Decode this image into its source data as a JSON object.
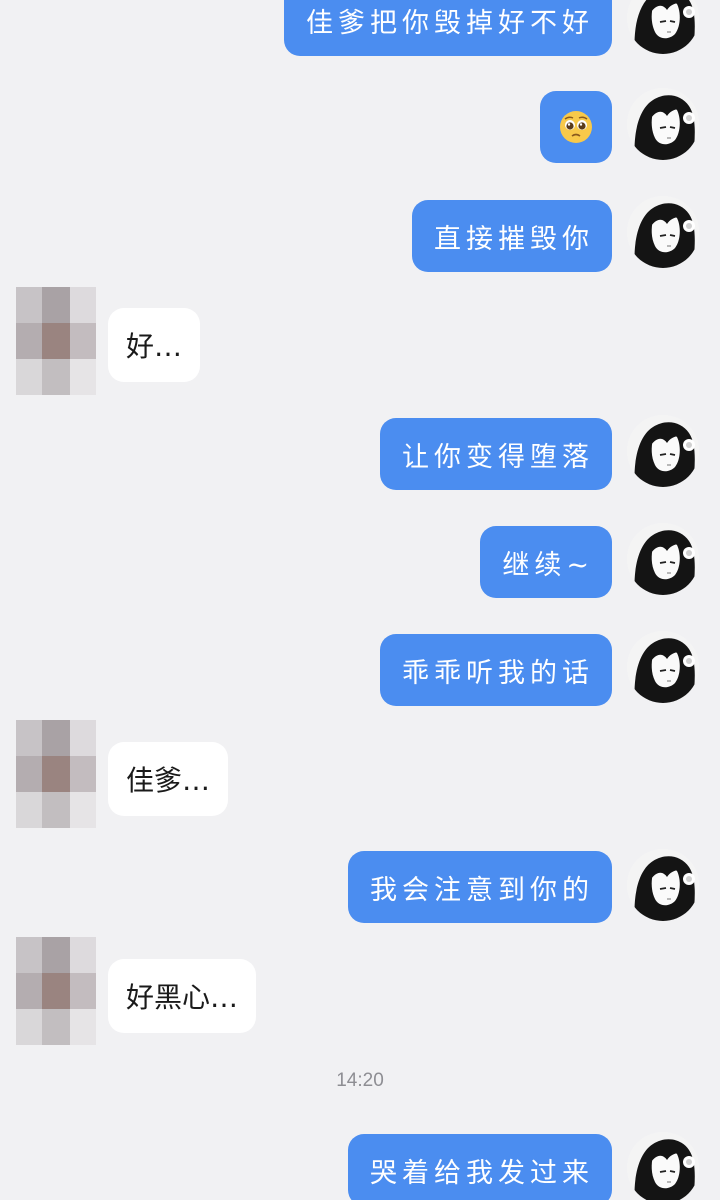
{
  "conversation": {
    "outgoing": [
      {
        "text": "佳爹把你毁掉好不好",
        "avatar_icon": "anime-girl-avatar-icon"
      },
      {
        "text": "",
        "emoji": "pleading-face-emoji",
        "avatar_icon": "anime-girl-avatar-icon"
      },
      {
        "text": "直接摧毁你",
        "avatar_icon": "anime-girl-avatar-icon"
      },
      {
        "text": "让你变得堕落",
        "avatar_icon": "anime-girl-avatar-icon"
      },
      {
        "text": "继续~",
        "avatar_icon": "anime-girl-avatar-icon"
      },
      {
        "text": "乖乖听我的话",
        "avatar_icon": "anime-girl-avatar-icon"
      },
      {
        "text": "我会注意到你的",
        "avatar_icon": "anime-girl-avatar-icon"
      },
      {
        "text": "哭着给我发过来",
        "avatar_icon": "anime-girl-avatar-icon"
      }
    ],
    "incoming": [
      {
        "text": "好…",
        "avatar_icon": "pixelated-avatar-icon"
      },
      {
        "text": "佳爹…",
        "avatar_icon": "pixelated-avatar-icon"
      },
      {
        "text": "好黑心…",
        "avatar_icon": "pixelated-avatar-icon"
      }
    ],
    "timestamp": "14:20"
  },
  "colors": {
    "background": "#f1f1f3",
    "outgoing_bubble": "#4b8df0",
    "incoming_bubble": "#ffffff",
    "timestamp_text": "#8e8e93"
  }
}
